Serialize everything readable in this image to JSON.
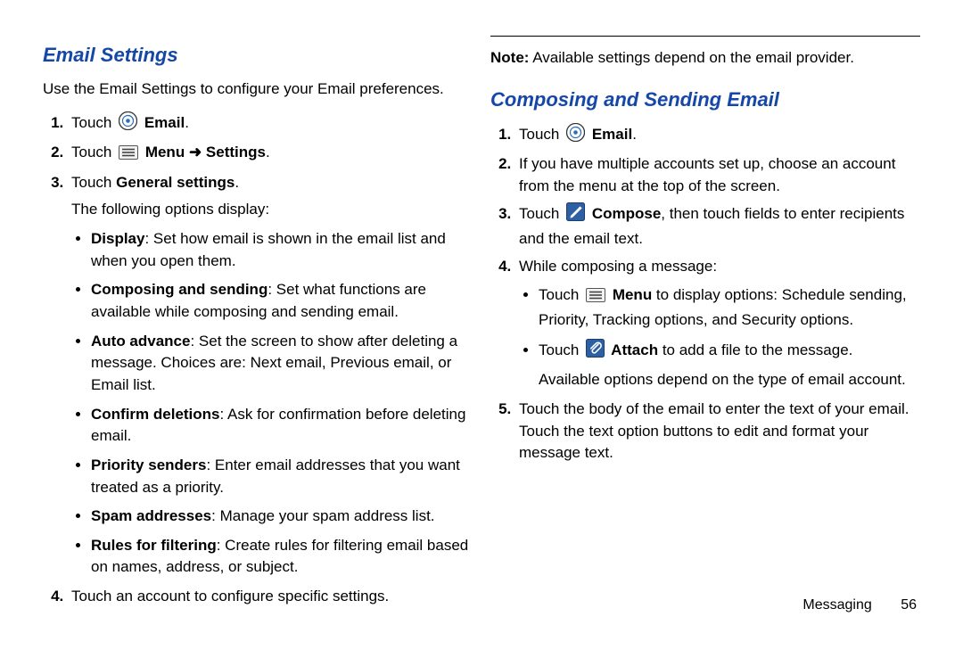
{
  "left": {
    "heading": "Email Settings",
    "intro": "Use the Email Settings to configure your Email preferences.",
    "s1_pre": "Touch ",
    "s1_bold": " Email",
    "s1_suf": ".",
    "s2_pre": "Touch ",
    "s2_bold1": " Menu ",
    "s2_arrow": "➜ ",
    "s2_bold2": "Settings",
    "s2_suf": ".",
    "s3_pre": "Touch ",
    "s3_bold": "General settings",
    "s3_suf": ".",
    "s3_sub": "The following options display:",
    "b1_bold": "Display",
    "b1_rest": ": Set how email is shown in the email list and when you open them.",
    "b2_bold": "Composing and sending",
    "b2_rest": ": Set what functions are available while composing and sending email.",
    "b3_bold": "Auto advance",
    "b3_rest": ": Set the screen to show after deleting a message. Choices are: Next email, Previous email, or Email list.",
    "b4_bold": "Confirm deletions",
    "b4_rest": ": Ask for confirmation before deleting email.",
    "b5_bold": "Priority senders",
    "b5_rest": ": Enter email addresses that you want treated as a priority.",
    "b6_bold": "Spam addresses",
    "b6_rest": ": Manage your spam address list.",
    "b7_bold": "Rules for filtering",
    "b7_rest": ": Create rules for filtering email based on names, address, or subject.",
    "s4": "Touch an account to configure specific settings."
  },
  "right": {
    "note_bold": "Note:",
    "note_rest": " Available settings depend on the email provider.",
    "heading": "Composing and Sending Email",
    "s1_pre": "Touch ",
    "s1_bold": " Email",
    "s1_suf": ".",
    "s2": "If you have multiple accounts set up, choose an account from the menu at the top of the screen.",
    "s3_pre": "Touch ",
    "s3_bold": " Compose",
    "s3_rest": ", then touch fields to enter recipients and the email text.",
    "s4": "While composing a message:",
    "b1_pre": "Touch ",
    "b1_bold": " Menu",
    "b1_rest": " to display options: Schedule sending, Priority, Tracking options, and Security options.",
    "b2_pre": "Touch ",
    "b2_bold": " Attach",
    "b2_rest": " to add a file to the message.",
    "b2_sub": "Available options depend on the type of email account.",
    "s5": "Touch the body of the email to enter the text of your email. Touch the text option buttons to edit and format your message text."
  },
  "footer": {
    "section": "Messaging",
    "page": "56"
  }
}
